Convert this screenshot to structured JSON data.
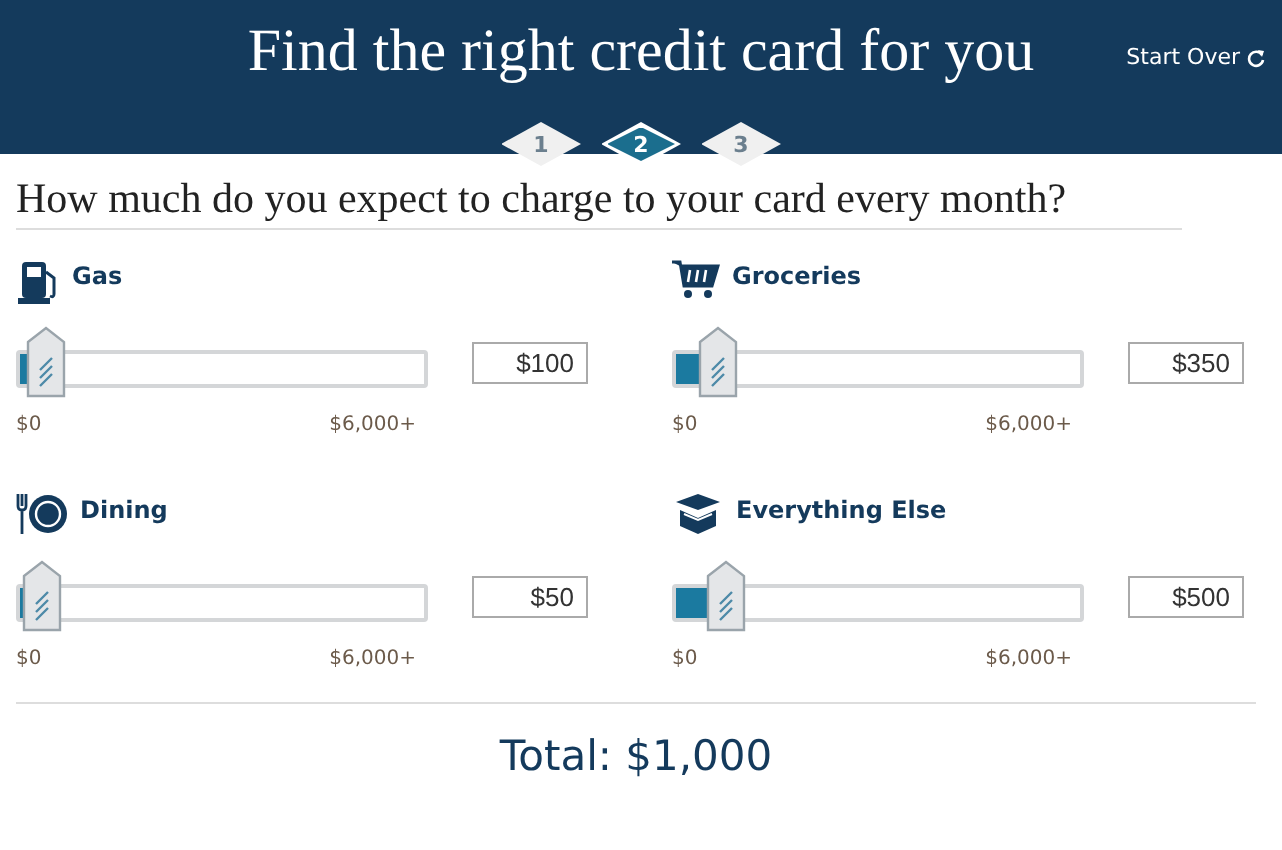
{
  "header": {
    "title": "Find the right credit card for you",
    "start_over": "Start Over"
  },
  "steps": [
    {
      "label": "1",
      "selected": false
    },
    {
      "label": "2",
      "selected": true
    },
    {
      "label": "3",
      "selected": false
    }
  ],
  "question": "How much do you expect to charge to your card every month?",
  "categories": [
    {
      "kind": "gas",
      "label": "Gas",
      "level": 0.017,
      "value": "$100",
      "min": "$0",
      "max": "$6,000+"
    },
    {
      "kind": "groceries",
      "label": "Groceries",
      "level": 0.058,
      "value": "$350",
      "min": "$0",
      "max": "$6,000+"
    },
    {
      "kind": "dining",
      "label": "Dining",
      "level": 0.008,
      "value": "$50",
      "min": "$0",
      "max": "$6,000+"
    },
    {
      "kind": "box",
      "label": "Everything Else",
      "level": 0.083,
      "value": "$500",
      "min": "$0",
      "max": "$6,000+"
    }
  ],
  "total": "Total: $1,000"
}
